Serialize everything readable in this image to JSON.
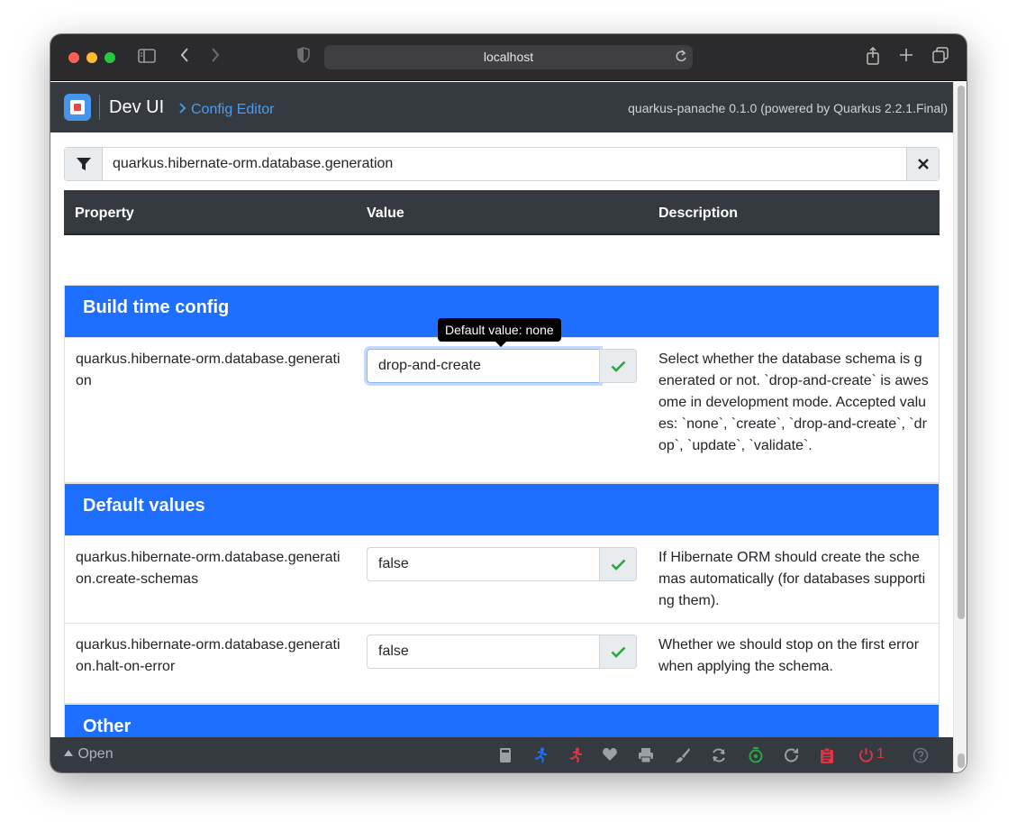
{
  "browser": {
    "url": "localhost",
    "traffic_lights": [
      "#fe5f57",
      "#febc2e",
      "#28c840"
    ]
  },
  "header": {
    "app_title": "Dev UI",
    "breadcrumb": "Config Editor",
    "powered_by": "quarkus-panache 0.1.0 (powered by Quarkus 2.2.1.Final)"
  },
  "filter": {
    "value": "quarkus.hibernate-orm.database.generation"
  },
  "table": {
    "columns": [
      "Property",
      "Value",
      "Description"
    ]
  },
  "tooltip": "Default value: none",
  "sections": [
    {
      "title": "Build time config",
      "rows": [
        {
          "property": "quarkus.hibernate-orm.database.generation",
          "value": "drop-and-create",
          "description": "Select whether the database schema is generated or not. `drop-and-create` is awesome in development mode. Accepted values: `none`, `create`, `drop-and-create`, `drop`, `update`, `validate`."
        }
      ]
    },
    {
      "title": "Default values",
      "rows": [
        {
          "property": "quarkus.hibernate-orm.database.generation.create-schemas",
          "value": "false",
          "description": "If Hibernate ORM should create the schemas automatically (for databases supporting them)."
        },
        {
          "property": "quarkus.hibernate-orm.database.generation.halt-on-error",
          "value": "false",
          "description": "Whether we should stop on the first error when applying the schema."
        }
      ]
    },
    {
      "title": "Other",
      "rows": []
    }
  ],
  "footer": {
    "open_label": "Open",
    "error_count": "1",
    "colors": {
      "icon_gray": "#9aa0a6",
      "blue": "#1e6fff",
      "red": "#dc3545",
      "green": "#28a745"
    }
  }
}
